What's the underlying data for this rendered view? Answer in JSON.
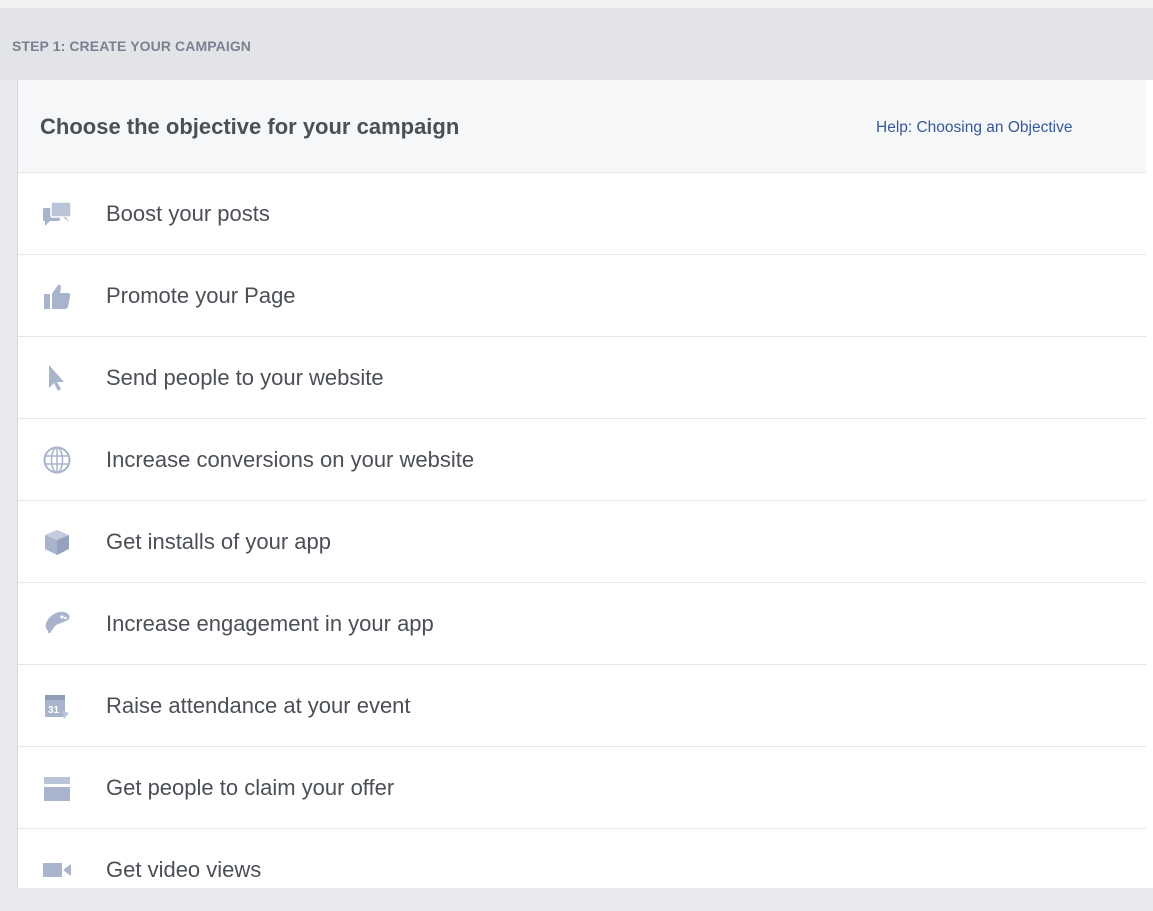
{
  "step": {
    "label": "STEP 1: CREATE YOUR CAMPAIGN"
  },
  "panel": {
    "title": "Choose the objective for your campaign",
    "help_link": "Help: Choosing an Objective"
  },
  "objectives": [
    {
      "label": "Boost your posts",
      "icon": "speech-bubbles-icon"
    },
    {
      "label": "Promote your Page",
      "icon": "thumbs-up-icon"
    },
    {
      "label": "Send people to your website",
      "icon": "cursor-icon"
    },
    {
      "label": "Increase conversions on your website",
      "icon": "globe-icon"
    },
    {
      "label": "Get installs of your app",
      "icon": "box-icon"
    },
    {
      "label": "Increase engagement in your app",
      "icon": "game-controller-icon"
    },
    {
      "label": "Raise attendance at your event",
      "icon": "calendar-icon"
    },
    {
      "label": "Get people to claim your offer",
      "icon": "storefront-icon"
    },
    {
      "label": "Get video views",
      "icon": "video-camera-icon"
    }
  ],
  "colors": {
    "icon": "#a8b4cc",
    "text": "#4b4f56",
    "link": "#365899",
    "step_text": "#7b8191"
  }
}
